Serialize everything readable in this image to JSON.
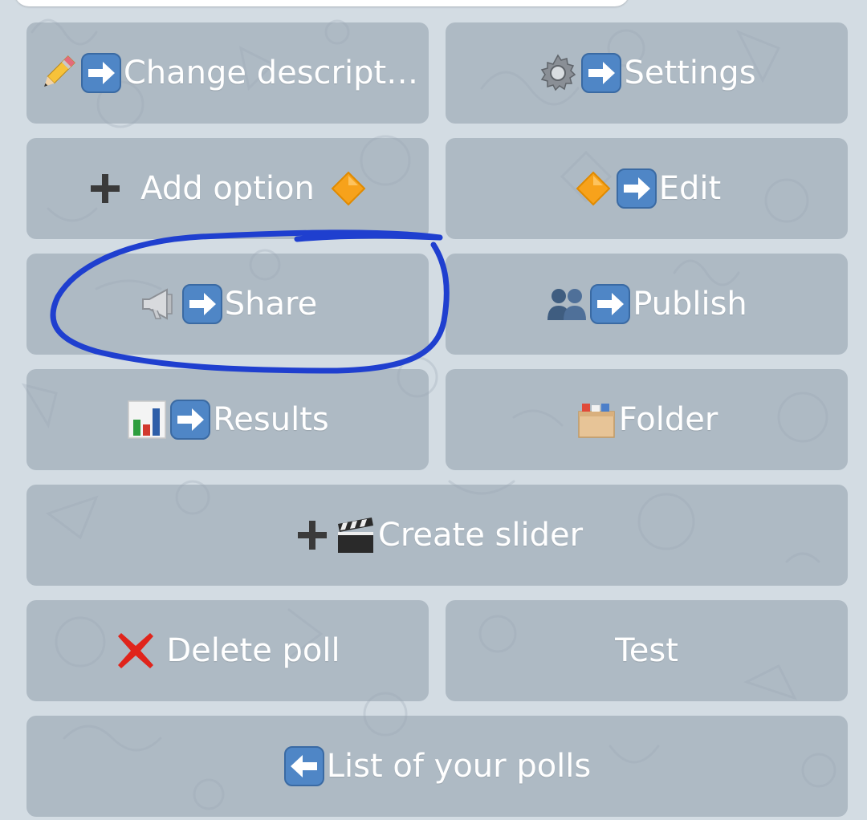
{
  "keyboard": {
    "buttons": [
      {
        "id": "change-description",
        "label": "Change descript…",
        "icons": [
          "pencil-icon",
          "right-arrow-icon"
        ]
      },
      {
        "id": "settings",
        "label": "Settings",
        "icons": [
          "gear-icon",
          "right-arrow-icon"
        ]
      },
      {
        "id": "add-option",
        "label": "Add option",
        "icons": [
          "plus-icon",
          "orange-diamond-icon"
        ]
      },
      {
        "id": "edit",
        "label": "Edit",
        "icons": [
          "orange-diamond-icon",
          "right-arrow-icon"
        ]
      },
      {
        "id": "share",
        "label": "Share",
        "icons": [
          "megaphone-icon",
          "right-arrow-icon"
        ]
      },
      {
        "id": "publish",
        "label": "Publish",
        "icons": [
          "people-icon",
          "right-arrow-icon"
        ]
      },
      {
        "id": "results",
        "label": "Results",
        "icons": [
          "bar-chart-icon",
          "right-arrow-icon"
        ]
      },
      {
        "id": "folder",
        "label": "Folder",
        "icons": [
          "card-file-box-icon"
        ]
      },
      {
        "id": "create-slider",
        "label": "Create slider",
        "icons": [
          "plus-icon",
          "clapper-board-icon"
        ]
      },
      {
        "id": "delete-poll",
        "label": "Delete poll",
        "icons": [
          "red-cross-icon"
        ]
      },
      {
        "id": "test",
        "label": "Test",
        "icons": []
      },
      {
        "id": "list-of-polls",
        "label": "List of your polls",
        "icons": [
          "left-arrow-icon"
        ]
      }
    ]
  },
  "annotation": {
    "highlighted_button": "share",
    "color": "#1f3fcf"
  },
  "colors": {
    "background": "#d3dce3",
    "button_fill": "rgba(152,164,178,0.62)",
    "button_text": "#ffffff"
  }
}
